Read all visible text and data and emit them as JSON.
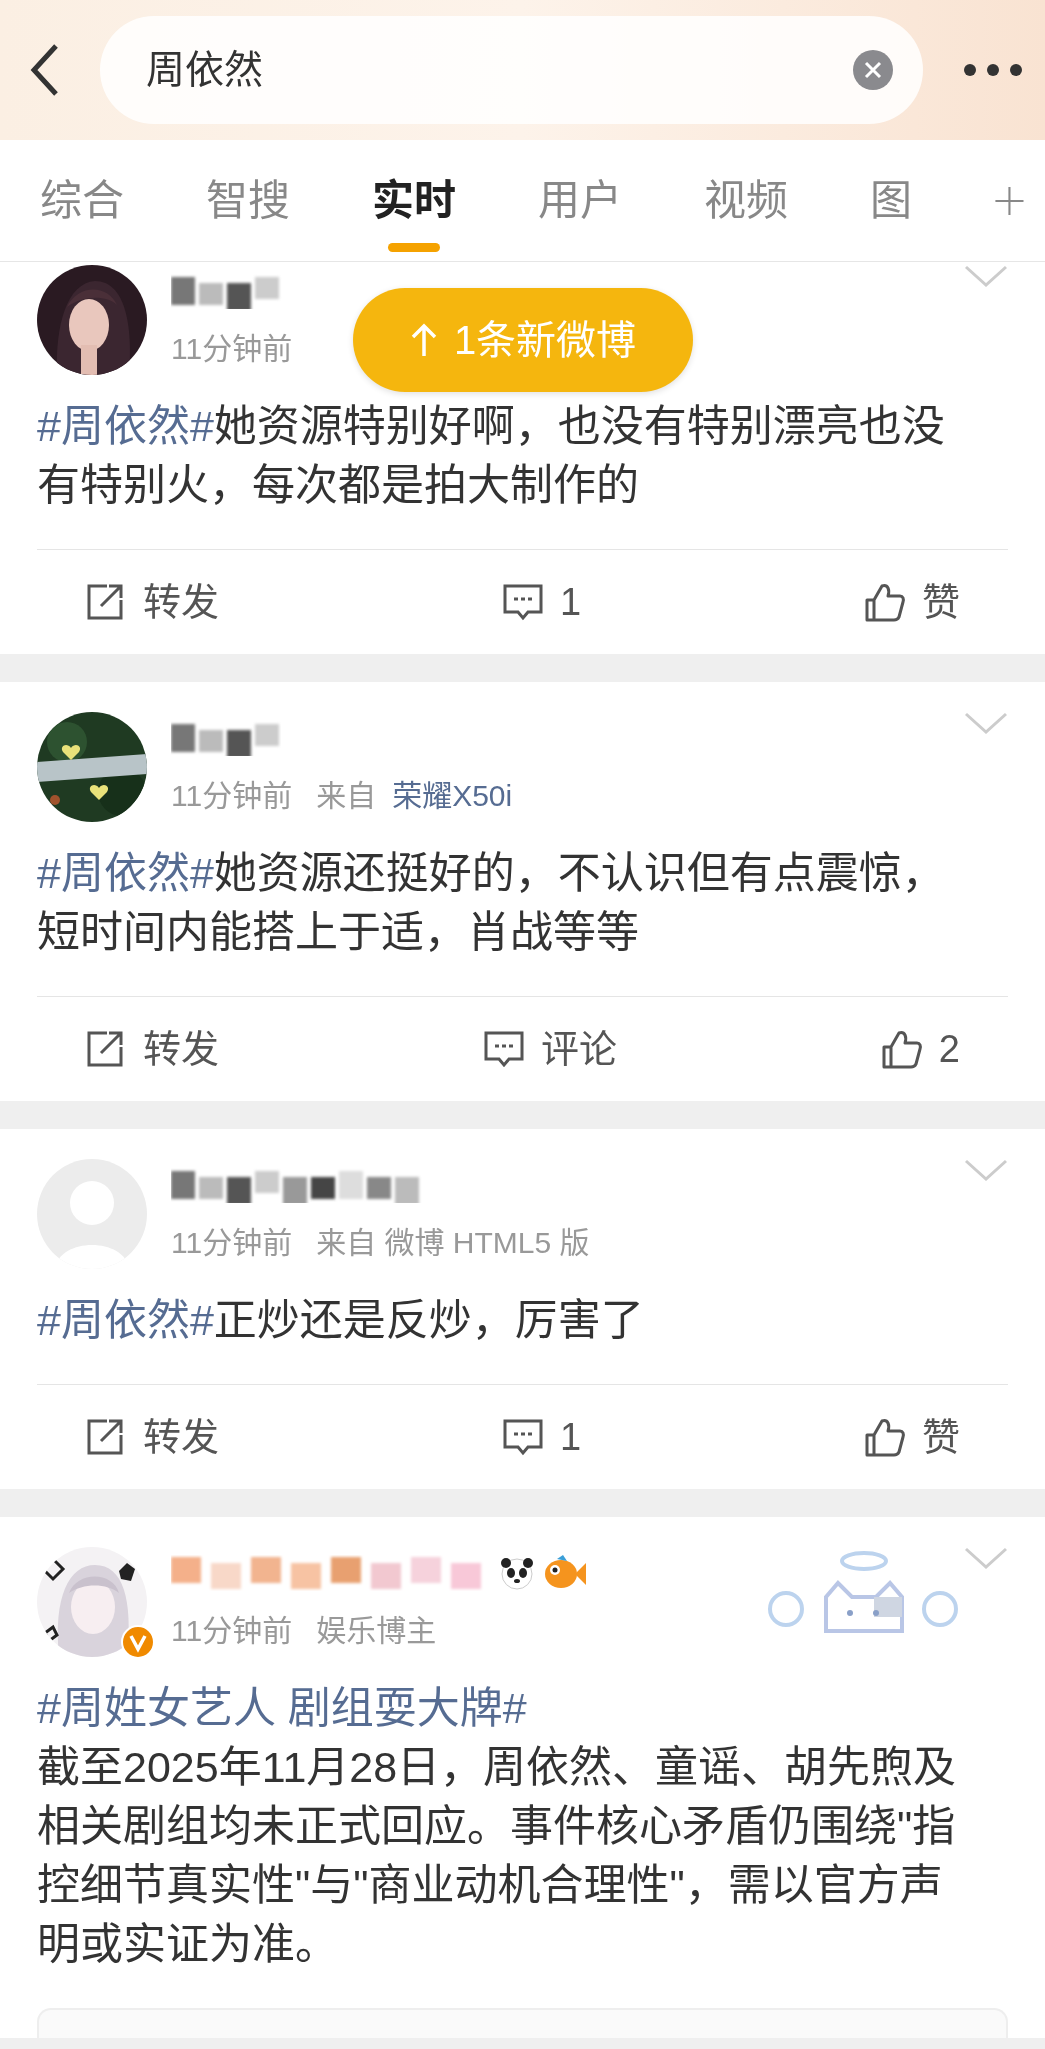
{
  "search": {
    "value": "周依然"
  },
  "tabs": [
    {
      "label": "综合",
      "selected": false
    },
    {
      "label": "智搜",
      "selected": false
    },
    {
      "label": "实时",
      "selected": true
    },
    {
      "label": "用户",
      "selected": false
    },
    {
      "label": "视频",
      "selected": false
    },
    {
      "label": "图",
      "selected": false
    }
  ],
  "toast": {
    "text": "1条新微博"
  },
  "posts": [
    {
      "avatar": {
        "kind": "picture"
      },
      "verified": false,
      "decorated": false,
      "time": "11分钟前",
      "hashtag": "#周依然#",
      "hashtag_own_line": false,
      "body": "她资源特别好啊，也没有特别漂亮也没有特别火，每次都是拍大制作的",
      "actions": {
        "repost": "转发",
        "comment": "1",
        "like": "赞"
      }
    },
    {
      "avatar": {
        "kind": "picture"
      },
      "verified": false,
      "decorated": false,
      "time": "11分钟前",
      "meta": [
        {
          "text": "来自",
          "kind": "plain"
        },
        {
          "text": "荣耀X50i",
          "kind": "link"
        }
      ],
      "hashtag": "#周依然#",
      "hashtag_own_line": false,
      "body": "她资源还挺好的，不认识但有点震惊，短时间内能搭上于适，肖战等等",
      "actions": {
        "repost": "转发",
        "comment": "评论",
        "like": "2"
      }
    },
    {
      "avatar": {
        "kind": "default"
      },
      "verified": false,
      "decorated": false,
      "time": "11分钟前",
      "meta": [
        {
          "text": "来自 微博 HTML5 版",
          "kind": "plain"
        }
      ],
      "hashtag": "#周依然#",
      "hashtag_own_line": false,
      "body": "正炒还是反炒，厉害了",
      "actions": {
        "repost": "转发",
        "comment": "1",
        "like": "赞"
      }
    },
    {
      "avatar": {
        "kind": "picture"
      },
      "verified": true,
      "decorated": true,
      "time": "11分钟前",
      "meta": [
        {
          "text": "娱乐博主",
          "kind": "plain"
        }
      ],
      "hashtag": "#周姓女艺人 剧组耍大牌#",
      "hashtag_own_line": true,
      "body": "截至2025年11月28日，周依然、童谣、胡先煦及相关剧组均未正式回应。事件核心矛盾仍围绕\"指控细节真实性\"与\"商业动机合理性\"，需以官方声明或实证为准。"
    }
  ]
}
